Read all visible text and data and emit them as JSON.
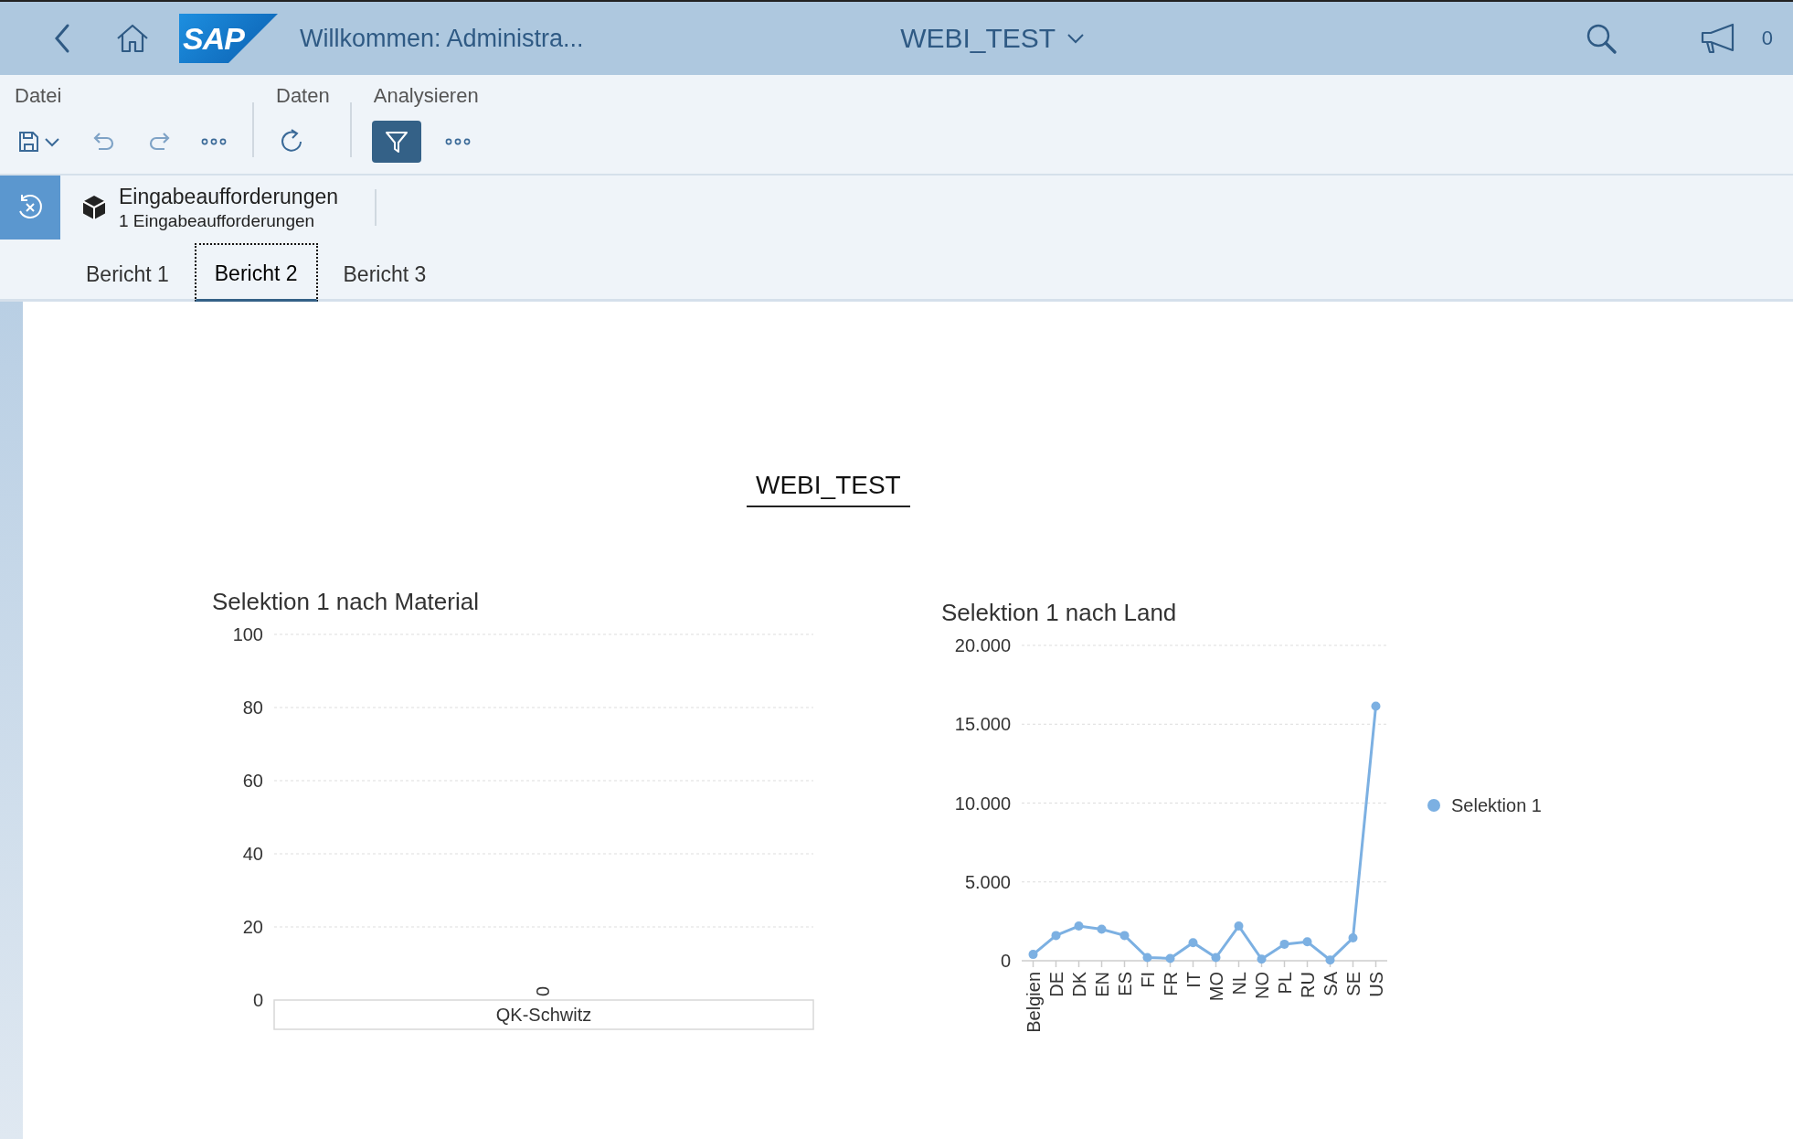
{
  "shell": {
    "logo": "SAP",
    "title": "Willkommen: Administra...",
    "app_title": "WEBI_TEST",
    "notifications": "0"
  },
  "toolbar": {
    "groups": [
      {
        "label": "Datei",
        "items": [
          {
            "kind": "save",
            "on": false
          },
          {
            "kind": "undo",
            "on": false
          },
          {
            "kind": "redo",
            "on": false
          },
          {
            "kind": "more",
            "on": false
          }
        ]
      },
      {
        "label": "Daten",
        "items": [
          {
            "kind": "refresh",
            "on": false
          }
        ]
      },
      {
        "label": "Analysieren",
        "items": [
          {
            "kind": "filter",
            "on": true
          },
          {
            "kind": "more",
            "on": false
          }
        ]
      }
    ]
  },
  "prompts": {
    "label": "Eingabeaufforderungen",
    "count": "1 Eingabeaufforderungen"
  },
  "tabs": [
    {
      "label": "Bericht 1",
      "selected": false
    },
    {
      "label": "Bericht 2",
      "selected": true
    },
    {
      "label": "Bericht 3",
      "selected": false
    }
  ],
  "report": {
    "title": "WEBI_TEST",
    "charts": [
      {
        "chart_data": {
          "type": "bar",
          "title": "Selektion 1 nach Material",
          "categories": [
            "QK-Schwitz"
          ],
          "values": [
            0
          ],
          "grid": true,
          "ylim": [
            0,
            100
          ],
          "yticks": [
            0,
            20,
            40,
            60,
            80,
            100
          ],
          "data_labels": true
        }
      },
      {
        "chart_data": {
          "type": "line",
          "title": "Selektion 1 nach Land",
          "categories": [
            "Belgien",
            "DE",
            "DK",
            "EN",
            "ES",
            "FI",
            "FR",
            "IT",
            "MO",
            "NL",
            "NO",
            "PL",
            "RU",
            "SA",
            "SE",
            "US"
          ],
          "grid": true,
          "series": [
            {
              "name": "Selektion 1",
              "color": "#7cb0e2",
              "marker": true,
              "values": [
                400,
                1600,
                2200,
                2000,
                1600,
                200,
                150,
                1150,
                200,
                2200,
                100,
                1050,
                1200,
                50,
                1450,
                16150
              ]
            }
          ],
          "ylim": [
            0,
            20000
          ],
          "yticks": [
            {
              "value": 0,
              "label": "0"
            },
            {
              "value": 5000,
              "label": "5.000"
            },
            {
              "value": 10000,
              "label": "10.000"
            },
            {
              "value": 15000,
              "label": "15.000"
            },
            {
              "value": 20000,
              "label": "20.000"
            }
          ]
        }
      }
    ]
  }
}
